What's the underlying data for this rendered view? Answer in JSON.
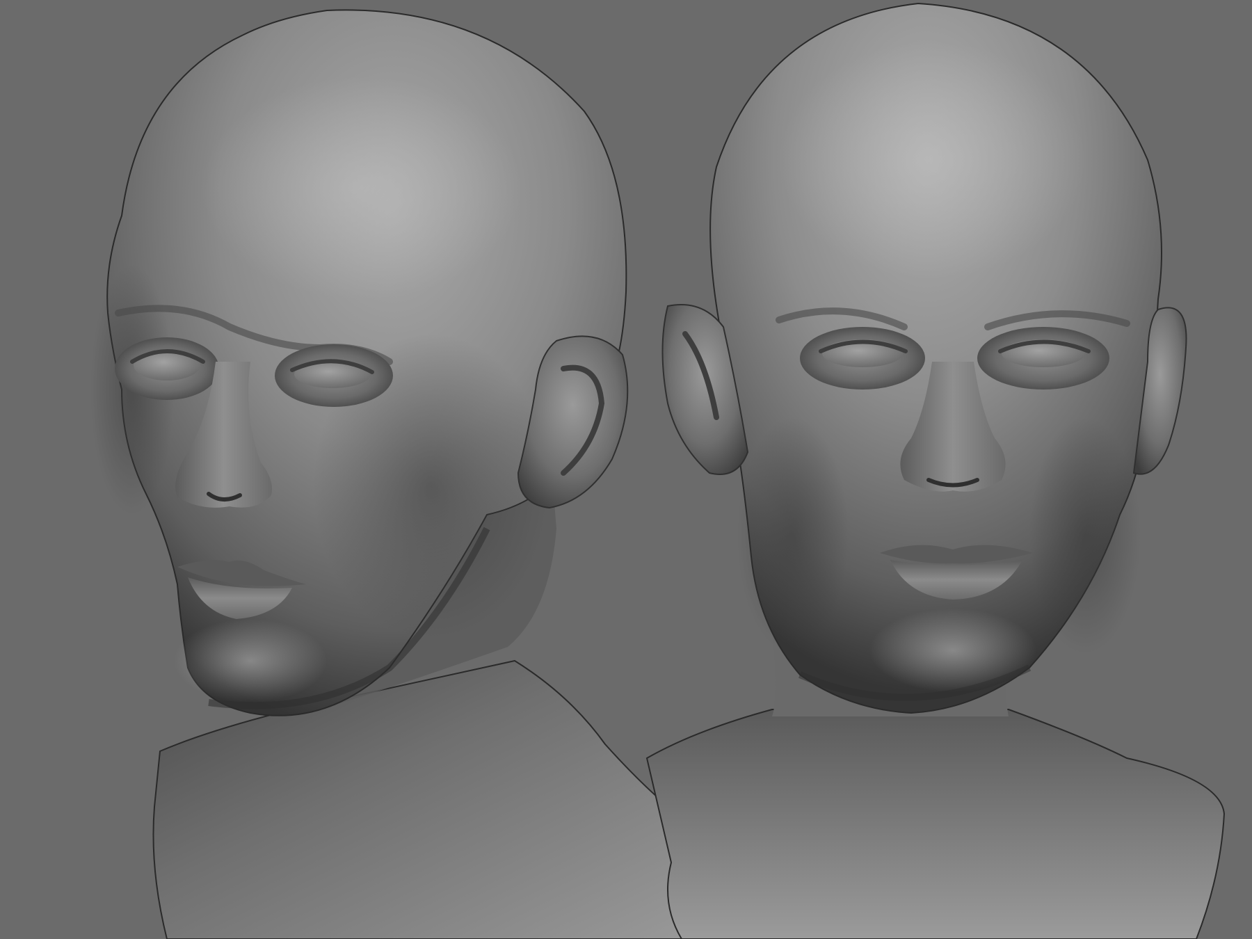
{
  "scene": {
    "background_color": "#6b6b6b",
    "material": "matcap-clay",
    "material_shadow": "#2b2b2b",
    "material_mid": "#6e6e6e",
    "material_highlight": "#b3b3b3",
    "models": [
      {
        "id": "head-three-quarter",
        "view": "three-quarter-left"
      },
      {
        "id": "head-front",
        "view": "front"
      }
    ]
  }
}
